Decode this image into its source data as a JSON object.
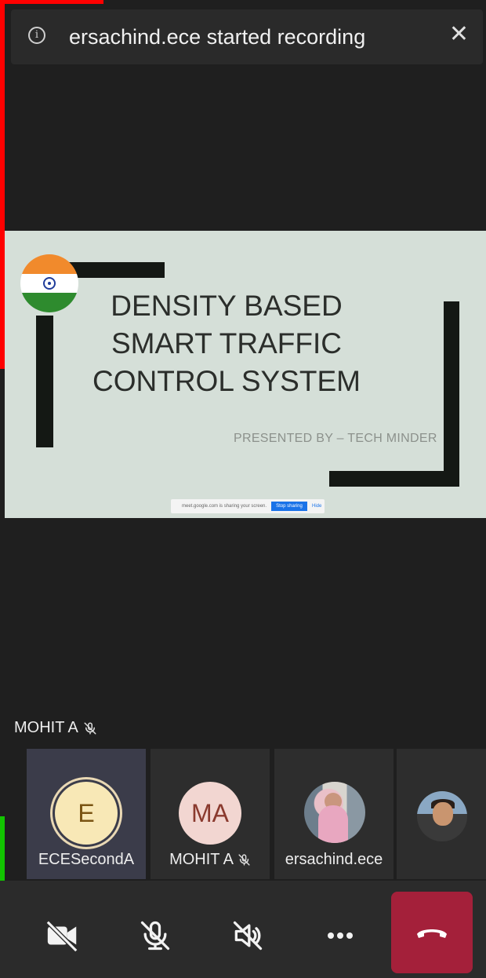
{
  "notification": {
    "message": "ersachind.ece started recording",
    "info_icon": "info-icon",
    "close_icon": "close-icon"
  },
  "slide": {
    "title_lines": [
      "DENSITY BASED",
      "SMART TRAFFIC",
      "CONTROL SYSTEM"
    ],
    "presented_by": "PRESENTED BY – TECH MINDER",
    "share_bar": {
      "message": "meet.google.com is sharing your screen.",
      "stop_label": "Stop sharing",
      "hide_label": "Hide"
    }
  },
  "active_speaker": {
    "name": "MOHIT A",
    "icon": "mic-off-icon"
  },
  "participants": [
    {
      "name": "ECESecondA",
      "initials": "E",
      "muted": false
    },
    {
      "name": "MOHIT A",
      "initials": "MA",
      "muted": true
    },
    {
      "name": "ersachind.ece",
      "initials": "",
      "muted": false
    },
    {
      "name": "",
      "initials": "",
      "muted": false
    }
  ],
  "controls": [
    "camera-off-icon",
    "mic-off-icon",
    "speaker-off-icon",
    "more-icon",
    "end-call-icon"
  ],
  "colors": {
    "background": "#1f1f1f",
    "slide_background": "#d5dfd8",
    "hangup": "#a4203a",
    "avatar_e": "#f8e8b6",
    "avatar_ma": "#f2d6d1"
  }
}
